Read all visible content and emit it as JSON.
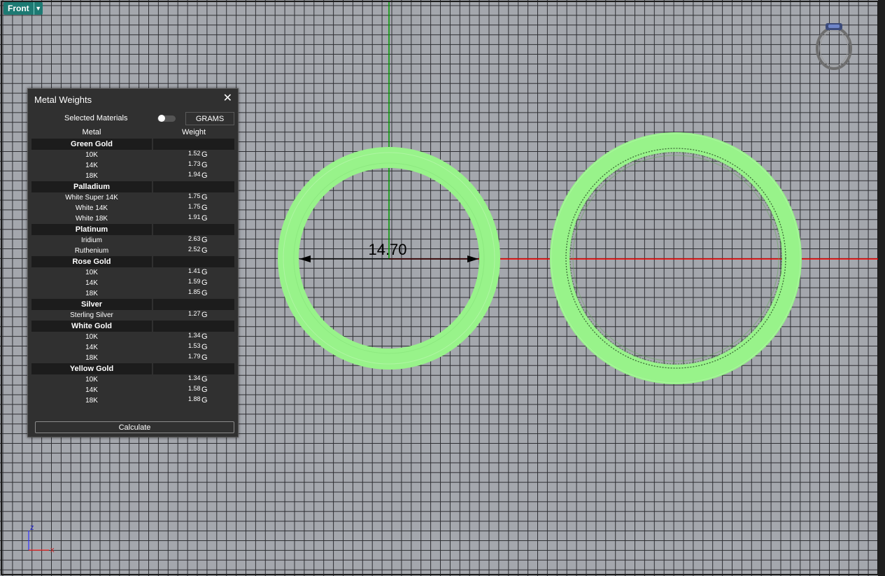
{
  "viewport": {
    "name": "Front",
    "dimension_label": "14.70",
    "axis_labels": {
      "z": "z",
      "x": "x"
    },
    "colors": {
      "background": "#a4a7ad",
      "grid": "#2e2f33",
      "ring": "#98f38a",
      "x_axis": "#ff0000",
      "y_axis": "#009a00"
    }
  },
  "panel": {
    "title": "Metal Weights",
    "close_glyph": "✕",
    "selected_materials_label": "Selected Materials",
    "selected_materials_on": false,
    "unit_button_label": "GRAMS",
    "columns": {
      "metal": "Metal",
      "weight": "Weight"
    },
    "calculate_label": "Calculate",
    "groups": [
      {
        "name": "Green Gold",
        "items": [
          {
            "name": "10K",
            "weight": "1.52",
            "unit": "G"
          },
          {
            "name": "14K",
            "weight": "1.73",
            "unit": "G"
          },
          {
            "name": "18K",
            "weight": "1.94",
            "unit": "G"
          }
        ]
      },
      {
        "name": "Palladium",
        "items": [
          {
            "name": "White Super 14K",
            "weight": "1.75",
            "unit": "G"
          },
          {
            "name": "White 14K",
            "weight": "1.75",
            "unit": "G"
          },
          {
            "name": "White 18K",
            "weight": "1.91",
            "unit": "G"
          }
        ]
      },
      {
        "name": "Platinum",
        "items": [
          {
            "name": "Iridium",
            "weight": "2.63",
            "unit": "G"
          },
          {
            "name": "Ruthenium",
            "weight": "2.52",
            "unit": "G"
          }
        ]
      },
      {
        "name": "Rose Gold",
        "items": [
          {
            "name": "10K",
            "weight": "1.41",
            "unit": "G"
          },
          {
            "name": "14K",
            "weight": "1.59",
            "unit": "G"
          },
          {
            "name": "18K",
            "weight": "1.85",
            "unit": "G"
          }
        ]
      },
      {
        "name": "Silver",
        "items": [
          {
            "name": "Sterling Silver",
            "weight": "1.27",
            "unit": "G"
          }
        ]
      },
      {
        "name": "White Gold",
        "items": [
          {
            "name": "10K",
            "weight": "1.34",
            "unit": "G"
          },
          {
            "name": "14K",
            "weight": "1.53",
            "unit": "G"
          },
          {
            "name": "18K",
            "weight": "1.79",
            "unit": "G"
          }
        ]
      },
      {
        "name": "Yellow Gold",
        "items": [
          {
            "name": "10K",
            "weight": "1.34",
            "unit": "G"
          },
          {
            "name": "14K",
            "weight": "1.58",
            "unit": "G"
          },
          {
            "name": "18K",
            "weight": "1.88",
            "unit": "G"
          }
        ]
      }
    ]
  }
}
